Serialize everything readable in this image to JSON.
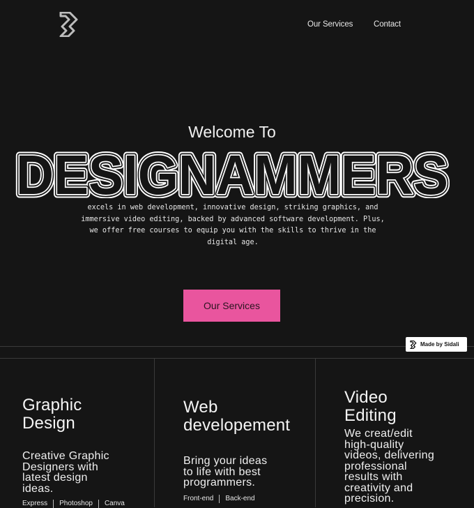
{
  "header": {
    "logo_icon": "designammers-logo-icon",
    "nav": [
      {
        "label": "Our Services"
      },
      {
        "label": "Contact"
      }
    ]
  },
  "hero": {
    "welcome": "Welcome To",
    "brand": "DESIGNAMMERS",
    "tagline": "excels in web development, innovative design, striking graphics, and immersive video editing, backed by advanced software development. Plus, we offer free courses to equip you with the skills to thrive in the digital age.",
    "cta_label": "Our Services",
    "cta_color": "#e9559e"
  },
  "badge": {
    "label": "Made by Sidali"
  },
  "services": [
    {
      "title_lines": [
        "Graphic",
        "Design"
      ],
      "desc_lines": [
        "Creative Graphic",
        "Designers with",
        "latest design",
        "ideas."
      ],
      "tags": [
        "Express",
        "Photoshop",
        "Canva"
      ]
    },
    {
      "title_lines": [
        "Web",
        "developement"
      ],
      "desc_lines": [
        "Bring your ideas",
        "to life with best",
        "programmers."
      ],
      "tags": [
        "Front-end",
        "Back-end"
      ]
    },
    {
      "title_lines": [
        "Video",
        "Editing"
      ],
      "desc_lines": [
        "We creat/edit",
        "high-quality",
        "videos, delivering",
        "professional",
        "results with",
        "creativity and",
        "precision."
      ],
      "tags": []
    }
  ],
  "colors": {
    "background": "#151515",
    "accent": "#e9559e",
    "text": "#f2f2f2"
  }
}
